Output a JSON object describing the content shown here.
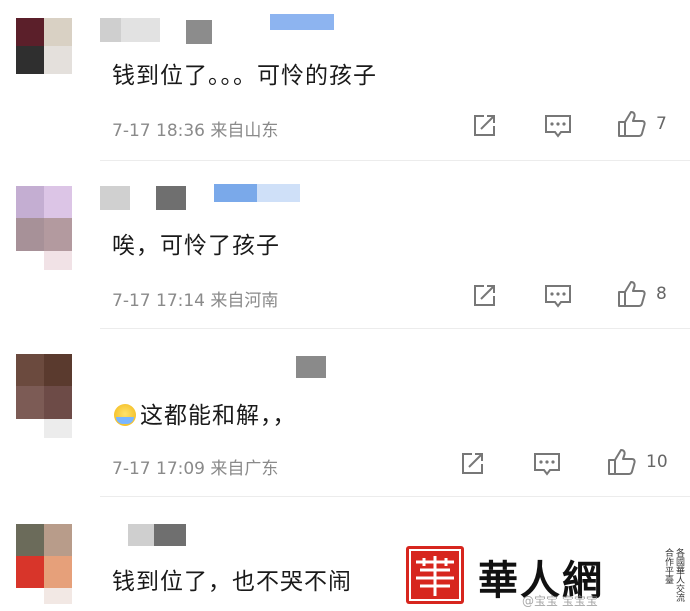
{
  "comments": [
    {
      "text": "钱到位了。。。可怜的孩子",
      "date": "7-17",
      "time": "18:36",
      "location": "来自山东",
      "likes": "7",
      "emoji": ""
    },
    {
      "text": "唉，可怜了孩子",
      "date": "7-17",
      "time": "17:14",
      "location": "来自河南",
      "likes": "8",
      "emoji": ""
    },
    {
      "text": "这都能和解，，",
      "date": "7-17",
      "time": "17:09",
      "location": "来自广东",
      "likes": "10",
      "emoji": "smiling-face-with-tear-emoji"
    },
    {
      "text": "钱到位了，也不哭不闹",
      "date": "",
      "time": "",
      "location": "",
      "likes": "",
      "emoji": ""
    }
  ],
  "watermark": {
    "brand": "華人網",
    "side_text": "各國華人交流合作平臺",
    "handle": "@宝宝 宝宝宝"
  },
  "colors": {
    "text": "#1a1a1a",
    "meta": "#8a8a8a",
    "icon": "#777777",
    "watermark_red": "#d7261e"
  },
  "icons": [
    "share-icon",
    "comment-icon",
    "like-icon"
  ]
}
